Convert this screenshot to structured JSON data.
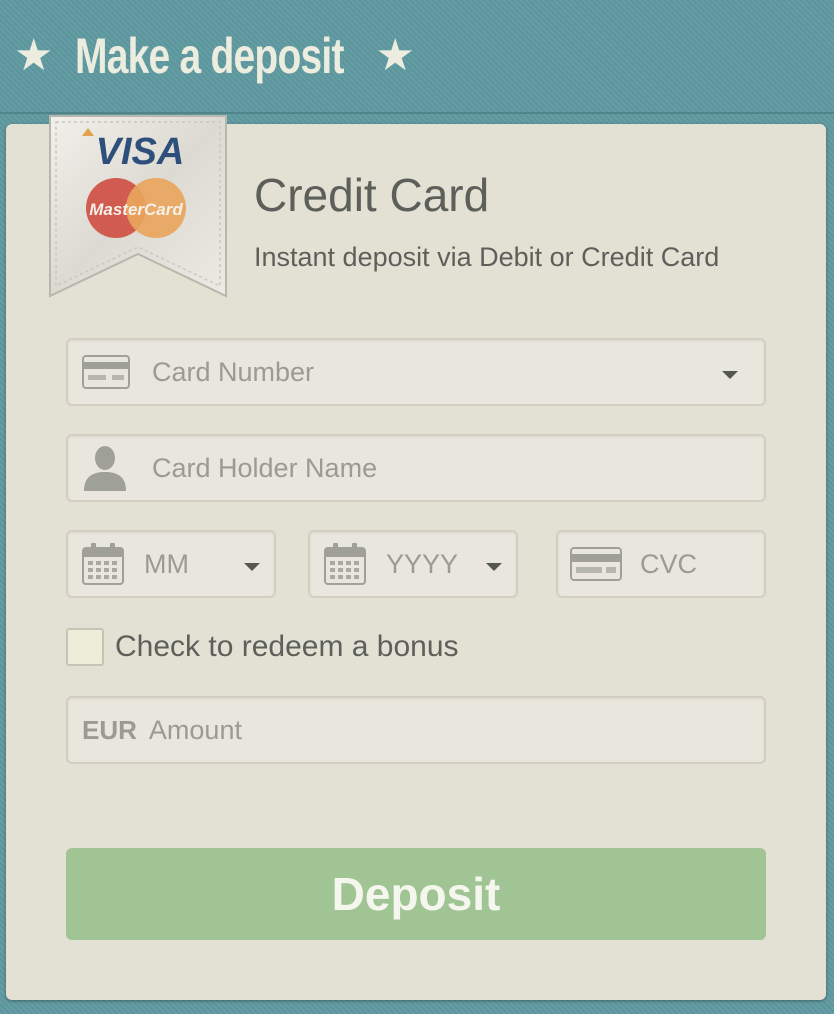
{
  "header": {
    "title": "Make a deposit",
    "star_left": "★",
    "star_right": "★"
  },
  "badge": {
    "visa": "VISA",
    "mastercard": "MasterCard"
  },
  "method": {
    "title": "Credit Card",
    "subtitle": "Instant deposit via Debit or Credit Card"
  },
  "form": {
    "card_number_placeholder": "Card Number",
    "card_holder_placeholder": "Card Holder Name",
    "month_placeholder": "MM",
    "year_placeholder": "YYYY",
    "cvc_placeholder": "CVC",
    "bonus_label": "Check to redeem a bonus",
    "currency": "EUR",
    "amount_placeholder": "Amount",
    "submit_label": "Deposit"
  },
  "colors": {
    "background": "#5f9aa0",
    "panel": "#e3e1d4",
    "accent_button": "#a0c494",
    "text": "#5d605a",
    "placeholder": "#9a9b94"
  },
  "icons": [
    "star-icon",
    "credit-card-icon",
    "user-icon",
    "calendar-icon",
    "chevron-down-icon"
  ]
}
